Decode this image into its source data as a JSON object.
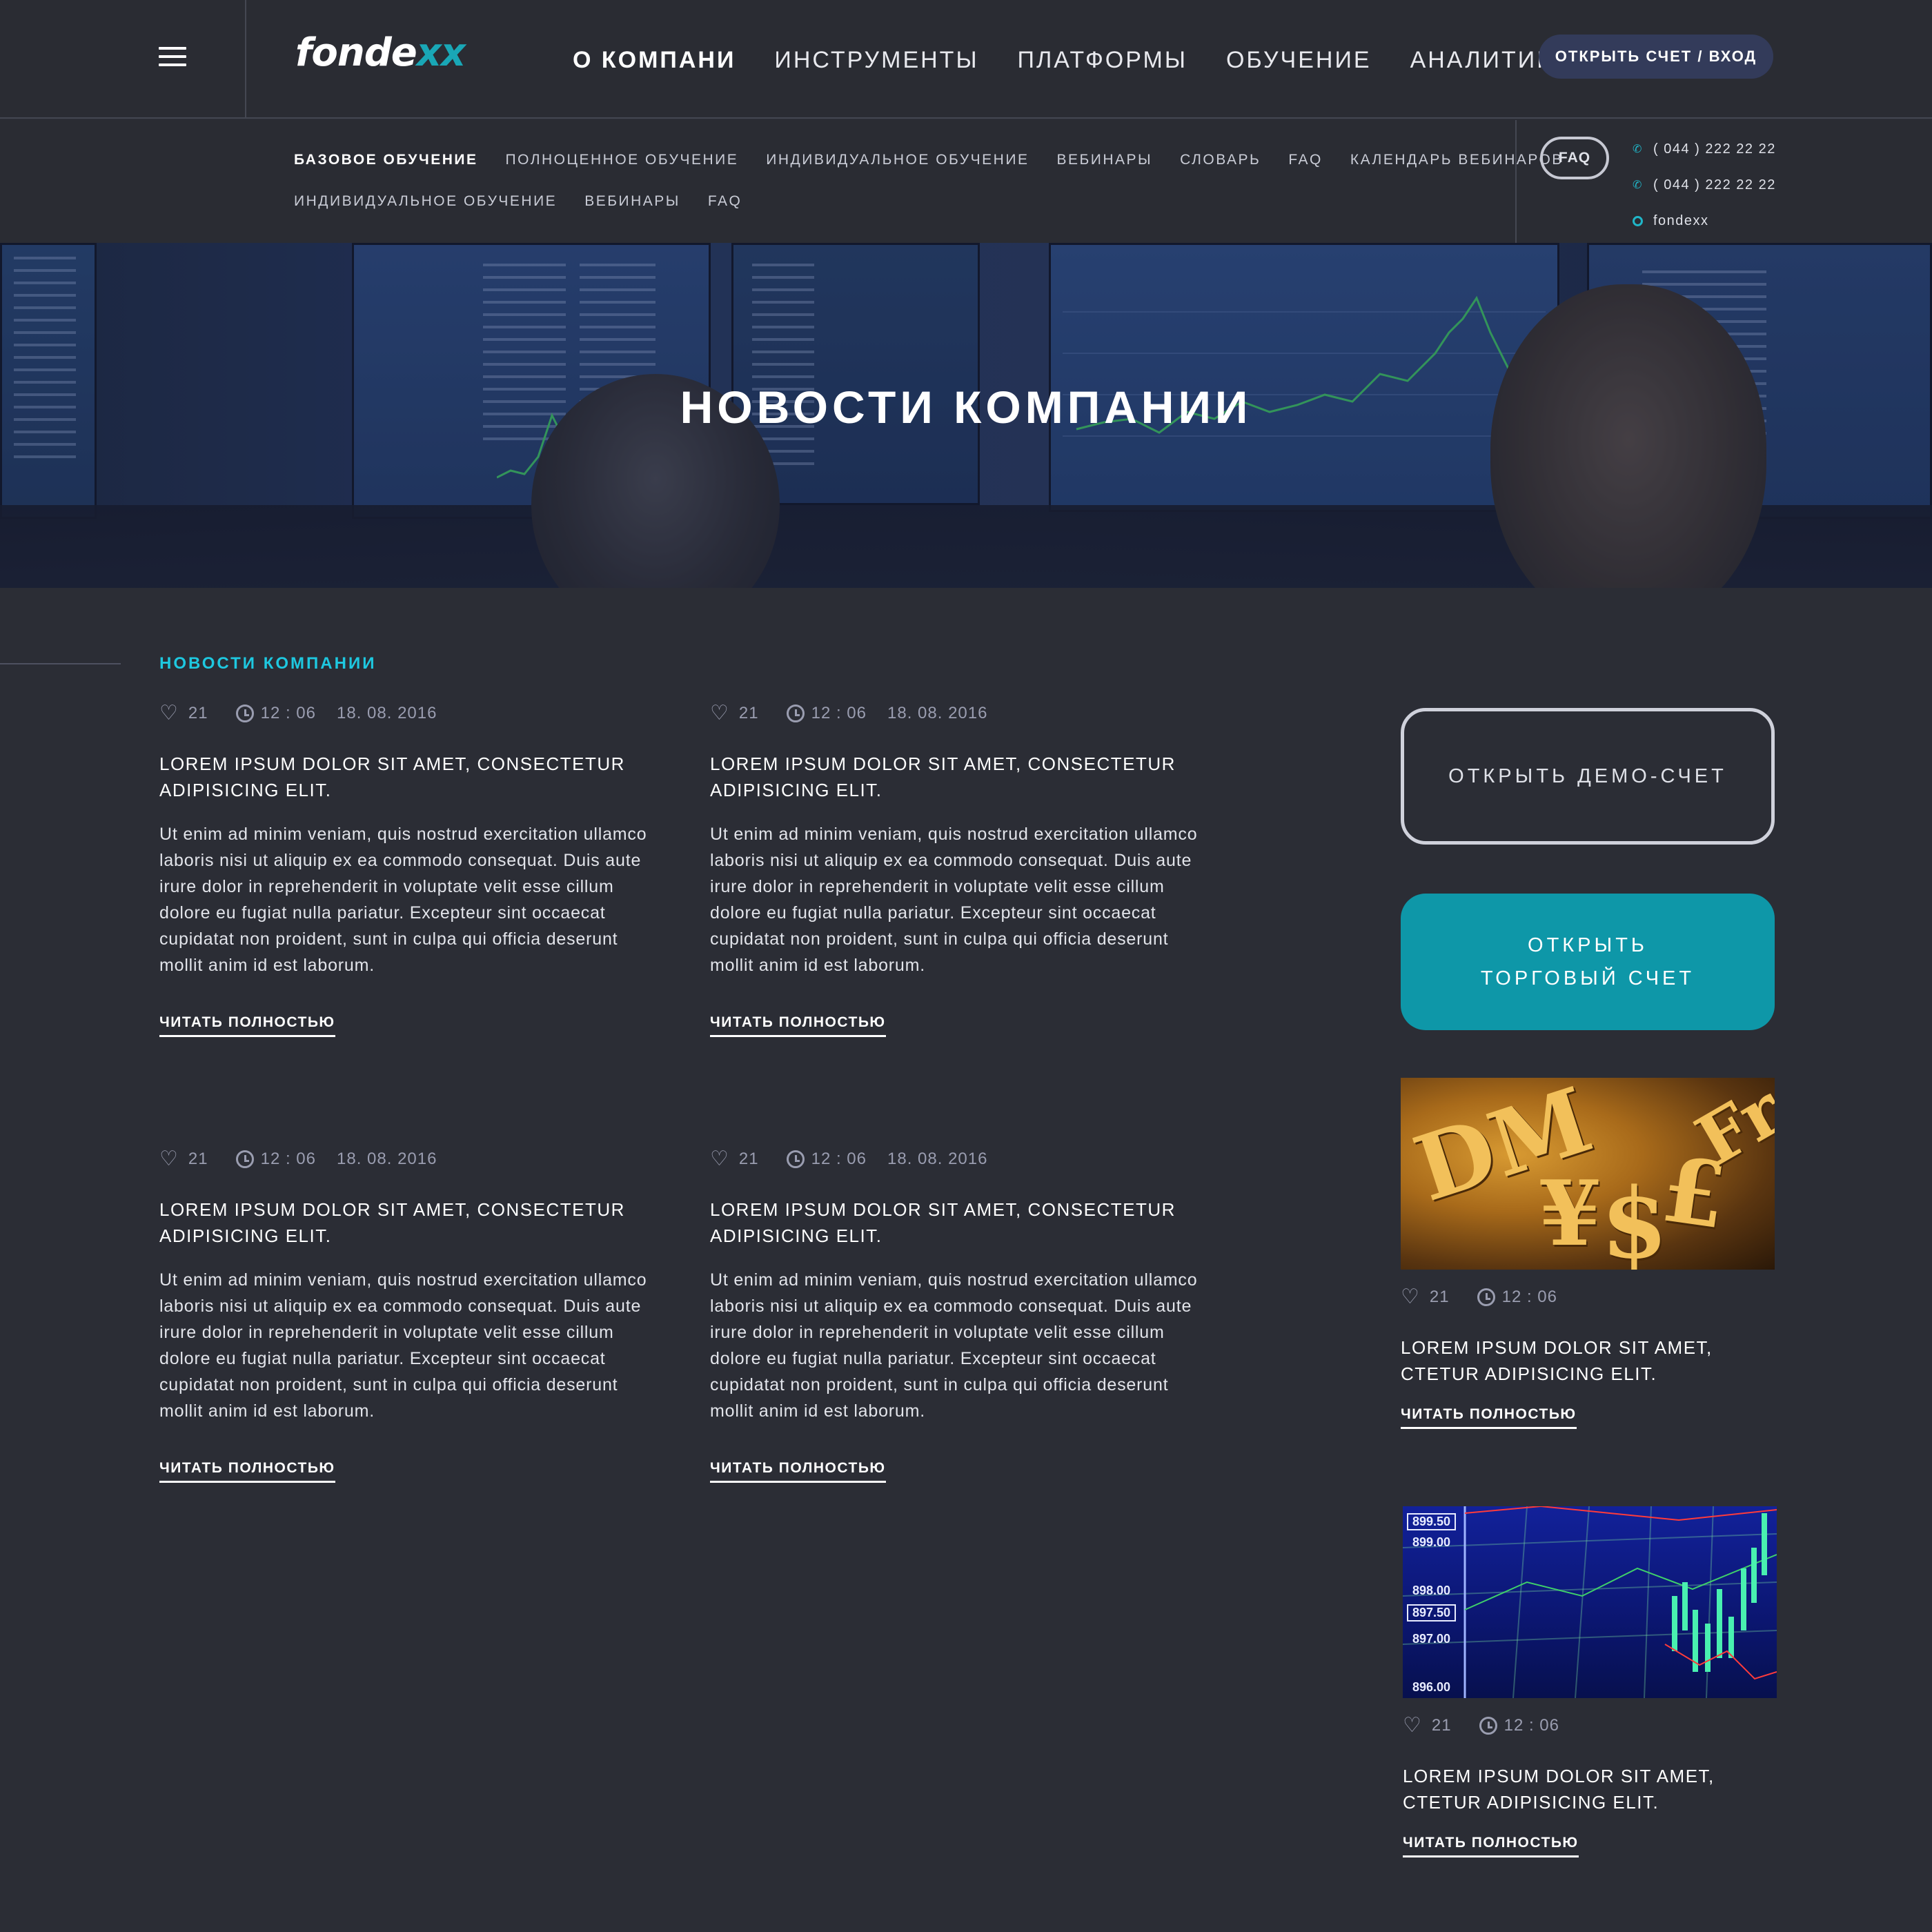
{
  "header": {
    "logo_part1": "fonde",
    "logo_part2": "xx",
    "nav": [
      "О КОМПАНИ",
      "ИНСТРУМЕНТЫ",
      "ПЛАТФОРМЫ",
      "ОБУЧЕНИЕ",
      "АНАЛИТИКА"
    ],
    "account_button": "ОТКРЫТЬ СЧЕТ / ВХОД"
  },
  "subnav": {
    "row1": [
      "БАЗОВОЕ ОБУЧЕНИЕ",
      "ПОЛНОЦЕННОЕ ОБУЧЕНИЕ",
      "ИНДИВИДУАЛЬНОЕ ОБУЧЕНИЕ",
      "ВЕБИНАРЫ",
      "СЛОВАРЬ",
      "FAQ",
      "КАЛЕНДАРЬ ВЕБИНАРОВ"
    ],
    "row2": [
      "ИНДИВИДУАЛЬНОЕ ОБУЧЕНИЕ",
      "ВЕБИНАРЫ",
      "FAQ"
    ],
    "faq_pill": "FAQ",
    "phone1": "( 044 ) 222 22 22",
    "phone2": "( 044 ) 222 22 22",
    "skype": "fondexx"
  },
  "hero": {
    "title": "НОВОСТИ КОМПАНИИ"
  },
  "section": {
    "title": "НОВОСТИ КОМПАНИИ"
  },
  "articles": [
    {
      "likes": "21",
      "time": "12 : 06",
      "date": "18. 08. 2016",
      "title": "LOREM IPSUM DOLOR SIT AMET, CONSECTETUR ADIPISICING ELIT.",
      "text": "Ut enim ad minim veniam, quis nostrud exercitation ullamco laboris nisi ut aliquip ex ea commodo consequat. Duis aute irure dolor in reprehenderit in voluptate velit esse cillum dolore eu fugiat nulla pariatur. Excepteur sint occaecat cupidatat non proident, sunt in culpa qui officia deserunt mollit anim id est laborum.",
      "read_more": "ЧИТАТЬ ПОЛНОСТЬЮ"
    },
    {
      "likes": "21",
      "time": "12 : 06",
      "date": "18. 08. 2016",
      "title": "LOREM IPSUM DOLOR SIT AMET, CONSECTETUR ADIPISICING ELIT.",
      "text": "Ut enim ad minim veniam, quis nostrud exercitation ullamco laboris nisi ut aliquip ex ea commodo consequat. Duis aute irure dolor in reprehenderit in voluptate velit esse cillum dolore eu fugiat nulla pariatur. Excepteur sint occaecat cupidatat non proident, sunt in culpa qui officia deserunt mollit anim id est laborum.",
      "read_more": "ЧИТАТЬ ПОЛНОСТЬЮ"
    },
    {
      "likes": "21",
      "time": "12 : 06",
      "date": "18. 08. 2016",
      "title": "LOREM IPSUM DOLOR SIT AMET, CONSECTETUR ADIPISICING ELIT.",
      "text": "Ut enim ad minim veniam, quis nostrud exercitation ullamco laboris nisi ut aliquip ex ea commodo consequat. Duis aute irure dolor in reprehenderit in voluptate velit esse cillum dolore eu fugiat nulla pariatur. Excepteur sint occaecat cupidatat non proident, sunt in culpa qui officia deserunt mollit anim id est laborum.",
      "read_more": "ЧИТАТЬ ПОЛНОСТЬЮ"
    },
    {
      "likes": "21",
      "time": "12 : 06",
      "date": "18. 08. 2016",
      "title": "LOREM IPSUM DOLOR SIT AMET, CONSECTETUR ADIPISICING ELIT.",
      "text": "Ut enim ad minim veniam, quis nostrud exercitation ullamco laboris nisi ut aliquip ex ea commodo consequat. Duis aute irure dolor in reprehenderit in voluptate velit esse cillum dolore eu fugiat nulla pariatur. Excepteur sint occaecat cupidatat non proident, sunt in culpa qui officia deserunt mollit anim id est laborum.",
      "read_more": "ЧИТАТЬ ПОЛНОСТЬЮ"
    }
  ],
  "sidebar": {
    "demo_button": "ОТКРЫТЬ ДЕМО-СЧЕТ",
    "trade_button_line1": "ОТКРЫТЬ",
    "trade_button_line2": "ТОРГОВЫЙ СЧЕТ",
    "cards": [
      {
        "likes": "21",
        "time": "12 : 06",
        "title": "LOREM IPSUM DOLOR SIT AMET, CTETUR ADIPISICING ELIT.",
        "read_more": "ЧИТАТЬ ПОЛНОСТЬЮ"
      },
      {
        "likes": "21",
        "time": "12 : 06",
        "title": "LOREM IPSUM DOLOR SIT AMET, CTETUR ADIPISICING ELIT.",
        "read_more": "ЧИТАТЬ ПОЛНОСТЬЮ"
      }
    ],
    "currency_symbols": [
      "DM",
      "¥",
      "$",
      "£",
      "Fr"
    ],
    "chart_labels": [
      "899.50",
      "899.00",
      "898.00",
      "897.50",
      "897.00",
      "896.00"
    ]
  },
  "colors": {
    "background": "#2b2d35",
    "accent": "#1ec8e0",
    "trade_button": "#0e97a8",
    "account_button": "#333b5a"
  },
  "icons": [
    "menu-icon",
    "phone-icon",
    "skype-icon",
    "heart-icon",
    "clock-icon"
  ]
}
